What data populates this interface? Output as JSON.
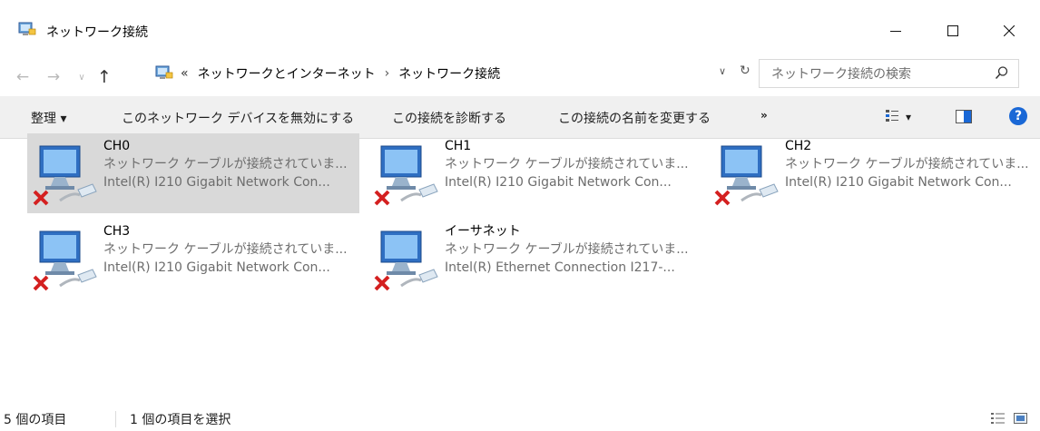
{
  "window": {
    "title": "ネットワーク接続",
    "buttons": {
      "minimize": "—",
      "maximize": "☐",
      "close": "✕"
    }
  },
  "navigation": {
    "back": "←",
    "forward": "→",
    "recent": "∨",
    "up": "↑",
    "address_chevrons": "«",
    "breadcrumbs": [
      "ネットワークとインターネット",
      "ネットワーク接続"
    ],
    "breadcrumb_separator": "›",
    "address_dropdown": "∨",
    "refresh": "↻",
    "search_placeholder": "ネットワーク接続の検索"
  },
  "toolbar": {
    "organize": "整理 ▾",
    "disable": "このネットワーク デバイスを無効にする",
    "diagnose": "この接続を診断する",
    "rename": "この接続の名前を変更する",
    "more": "»",
    "view_dropdown": "▾",
    "help": "?"
  },
  "connections": [
    {
      "name": "CH0",
      "status": "ネットワーク ケーブルが接続されていま...",
      "device": "Intel(R) I210 Gigabit Network Con...",
      "selected": true
    },
    {
      "name": "CH1",
      "status": "ネットワーク ケーブルが接続されていま...",
      "device": "Intel(R) I210 Gigabit Network Con...",
      "selected": false
    },
    {
      "name": "CH2",
      "status": "ネットワーク ケーブルが接続されていま...",
      "device": "Intel(R) I210 Gigabit Network Con...",
      "selected": false
    },
    {
      "name": "CH3",
      "status": "ネットワーク ケーブルが接続されていま...",
      "device": "Intel(R) I210 Gigabit Network Con...",
      "selected": false
    },
    {
      "name": "イーサネット",
      "status": "ネットワーク ケーブルが接続されていま...",
      "device": "Intel(R) Ethernet Connection I217-...",
      "selected": false
    }
  ],
  "statusbar": {
    "item_count": "5 個の項目",
    "selected_count": "1 個の項目を選択"
  },
  "colors": {
    "selection": "#d9d9d9",
    "toolbar_bg": "#f0f0f0",
    "help_blue": "#1a68d6",
    "error_red": "#d42020"
  }
}
